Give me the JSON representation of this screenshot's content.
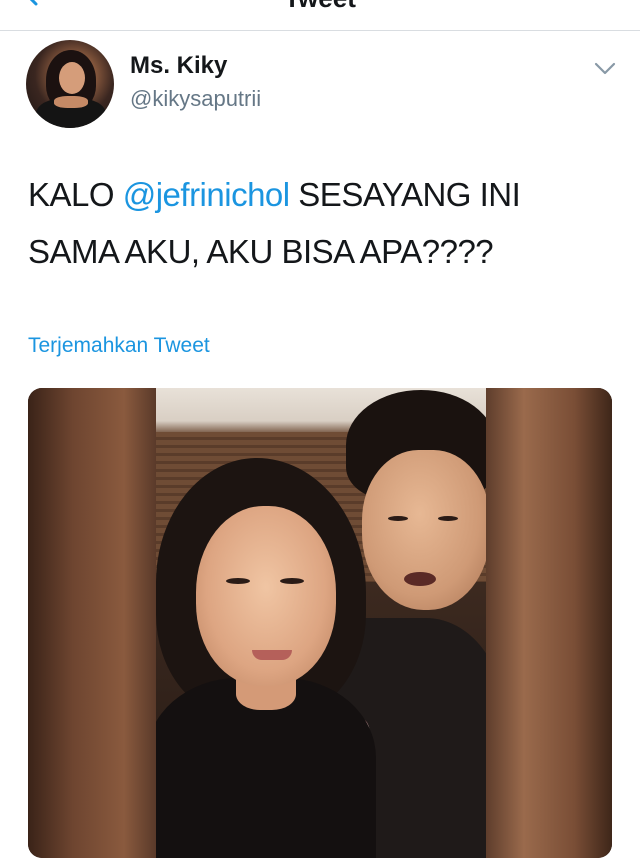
{
  "nav": {
    "title": "Tweet"
  },
  "author": {
    "name": "Ms. Kiky",
    "handle": "@kikysaputrii"
  },
  "tweet": {
    "text_before": "KALO ",
    "mention": "@jefrinichol",
    "text_after": " SESAYANG INI SAMA AKU, AKU BISA APA????"
  },
  "translate_label": "Terjemahkan Tweet",
  "colors": {
    "link_blue": "#1b95e0",
    "secondary_gray": "#657786",
    "text_black": "#14171a"
  },
  "icons": {
    "back": "chevron-left-icon",
    "menu": "chevron-down-icon"
  }
}
